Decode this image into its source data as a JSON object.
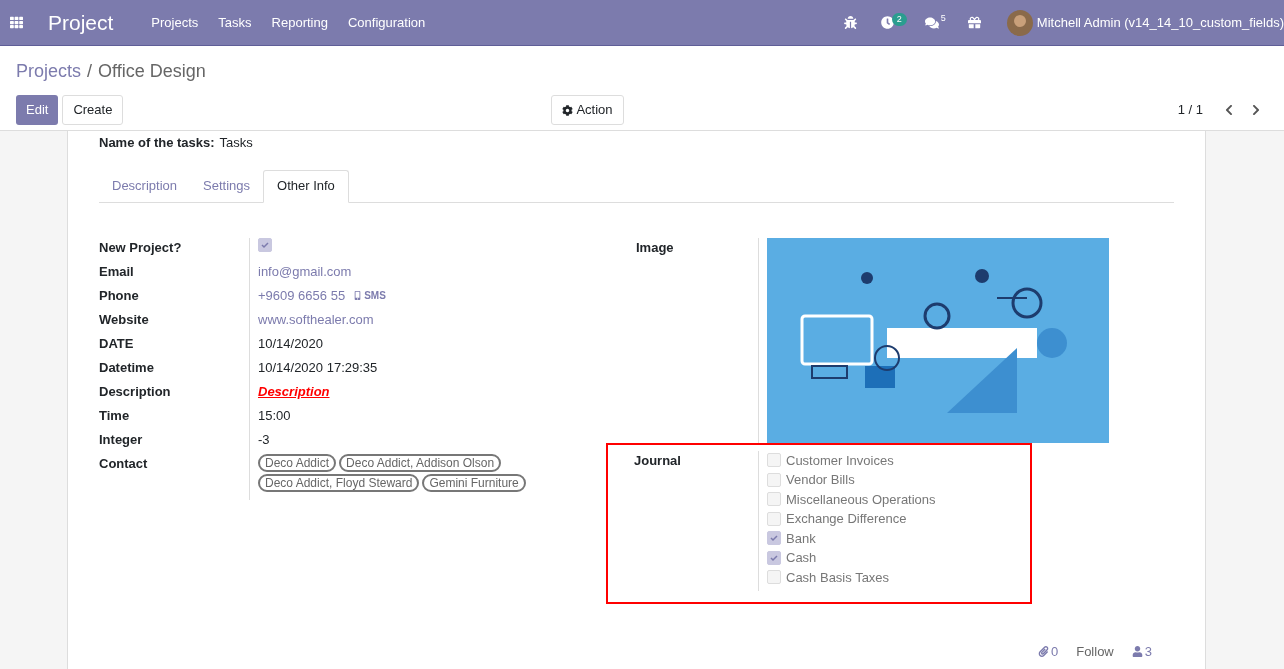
{
  "navbar": {
    "app_name": "Project",
    "menu": [
      "Projects",
      "Tasks",
      "Reporting",
      "Configuration"
    ],
    "activity_count": "2",
    "message_count": "5",
    "user": "Mitchell Admin (v14_14_10_custom_fields)"
  },
  "breadcrumb": {
    "parent": "Projects",
    "separator": "/",
    "current": "Office Design"
  },
  "buttons": {
    "edit": "Edit",
    "create": "Create",
    "action": "Action"
  },
  "pager": {
    "value": "1 / 1"
  },
  "form": {
    "top_field": {
      "label": "Name of the tasks:",
      "value": "Tasks"
    },
    "tabs": [
      {
        "label": "Description",
        "selected": false
      },
      {
        "label": "Settings",
        "selected": false
      },
      {
        "label": "Other Info",
        "selected": true
      }
    ],
    "fields": [
      {
        "kind": "checkbox",
        "label": "New Project?",
        "checked": true
      },
      {
        "kind": "link",
        "label": "Email",
        "value": "info@gmail.com"
      },
      {
        "kind": "phone",
        "label": "Phone",
        "value": "+9609 6656 55",
        "action": "SMS"
      },
      {
        "kind": "link",
        "label": "Website",
        "value": "www.softhealer.com"
      },
      {
        "kind": "text",
        "label": "DATE",
        "value": "10/14/2020"
      },
      {
        "kind": "text",
        "label": "Datetime",
        "value": "10/14/2020 17:29:35"
      },
      {
        "kind": "styled",
        "label": "Description",
        "value": "Description"
      },
      {
        "kind": "text",
        "label": "Time",
        "value": "15:00"
      },
      {
        "kind": "text",
        "label": "Integer",
        "value": "-3"
      },
      {
        "kind": "tags",
        "label": "Contact",
        "tags": [
          "Deco Addict",
          "Deco Addict, Addison Olson",
          "Deco Addict, Floyd Steward",
          "Gemini Furniture"
        ]
      }
    ],
    "image": {
      "label": "Image",
      "kind": "picture"
    },
    "journal": {
      "label": "Journal",
      "options": [
        {
          "label": "Customer Invoices",
          "checked": false
        },
        {
          "label": "Vendor Bills",
          "checked": false
        },
        {
          "label": "Miscellaneous Operations",
          "checked": false
        },
        {
          "label": "Exchange Difference",
          "checked": false
        },
        {
          "label": "Bank",
          "checked": true
        },
        {
          "label": "Cash",
          "checked": true
        },
        {
          "label": "Cash Basis Taxes",
          "checked": false
        }
      ]
    }
  },
  "chatter": {
    "attachments": "0",
    "follow": "Follow",
    "followers": "3"
  }
}
